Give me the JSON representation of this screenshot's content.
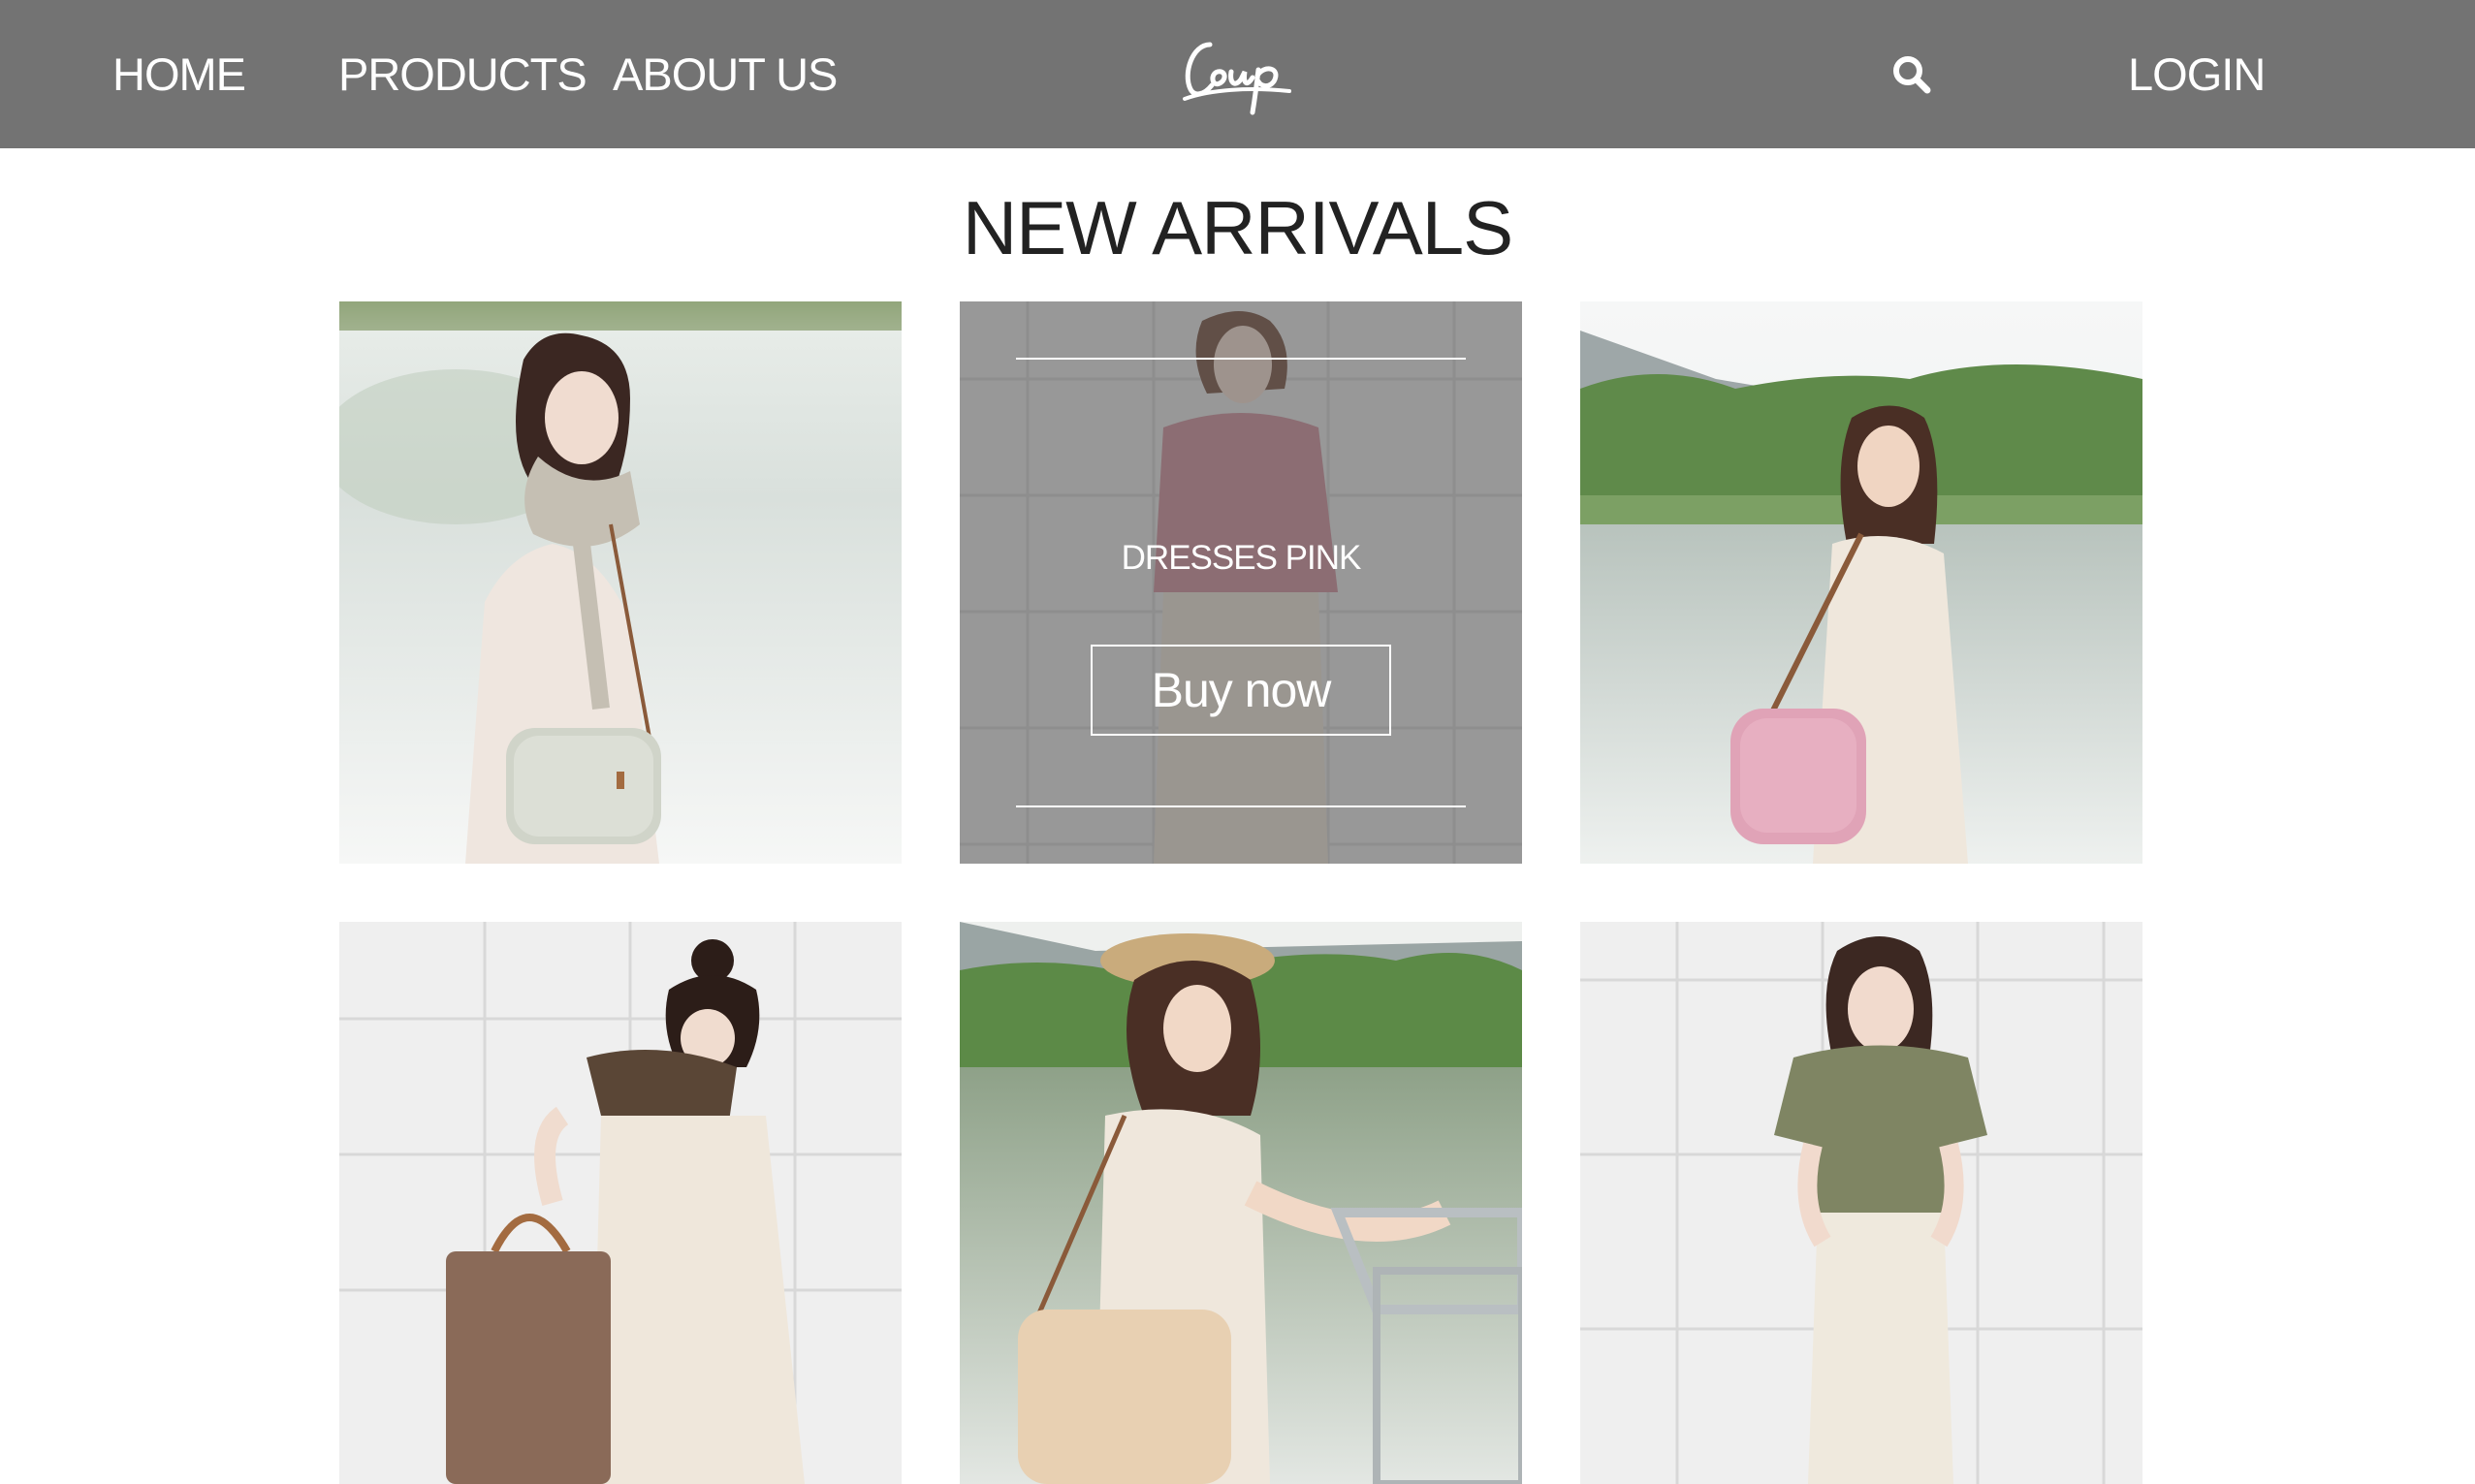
{
  "nav": {
    "home": "HOME",
    "products": "PRODUCTS",
    "about": "ABOUT US",
    "login": "LOGIN",
    "search_icon": "search-icon",
    "logo_text": "Coup"
  },
  "section": {
    "title": "NEW ARRIVALS"
  },
  "products": [
    {
      "image": "woman-gray-scarf-gray-bag-lake"
    },
    {
      "image": "woman-pink-knit-top-white-wall",
      "overlay_title": "DRESSES PINK",
      "button_label": "Buy now"
    },
    {
      "image": "woman-white-dress-pink-bag-lake"
    },
    {
      "image": "woman-brown-scarf-brown-tote-white-wall"
    },
    {
      "image": "woman-straw-hat-bicycle-lake"
    },
    {
      "image": "woman-green-lace-top-white-wall"
    }
  ],
  "colors": {
    "navbar": "#737373",
    "text_dark": "#222222",
    "white": "#ffffff"
  }
}
